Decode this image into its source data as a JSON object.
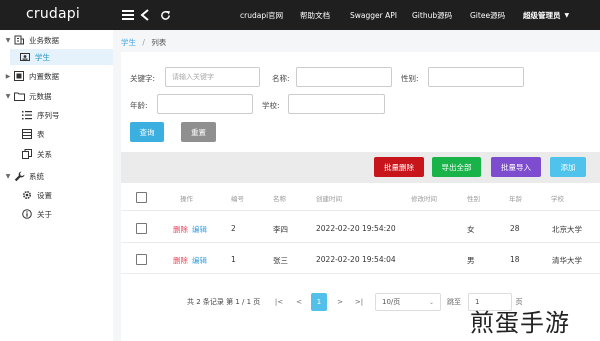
{
  "header": {
    "logo": "crudapi",
    "nav": [
      "crudapi官网",
      "帮助文档",
      "Swagger API",
      "Github源码",
      "Gitee源码"
    ],
    "user": "超级管理员"
  },
  "sidebar": {
    "items": [
      {
        "label": "业务数据",
        "level": 0,
        "expanded": true
      },
      {
        "label": "学生",
        "level": 1,
        "active": true
      },
      {
        "label": "内置数据",
        "level": 0,
        "expanded": false
      },
      {
        "label": "元数据",
        "level": 0,
        "expanded": true
      },
      {
        "label": "序列号",
        "level": 1
      },
      {
        "label": "表",
        "level": 1
      },
      {
        "label": "关系",
        "level": 1
      },
      {
        "label": "系统",
        "level": 0,
        "expanded": true
      },
      {
        "label": "设置",
        "level": 1
      },
      {
        "label": "关于",
        "level": 1
      }
    ]
  },
  "breadcrumb": {
    "parent": "学生",
    "separator": "/",
    "current": "列表"
  },
  "search": {
    "keyword_label": "关键字:",
    "keyword_placeholder": "请输入关键字",
    "name_label": "名称:",
    "gender_label": "性别:",
    "age_label": "年龄:",
    "school_label": "学校:",
    "query_button": "查询",
    "reset_button": "重置"
  },
  "toolbar": {
    "batch_delete": "批量删除",
    "export_all": "导出全部",
    "batch_import": "批量导入",
    "add": "添加"
  },
  "table": {
    "headers": [
      "操作",
      "编号",
      "名称",
      "创建时间",
      "修改时间",
      "性别",
      "年龄",
      "学校"
    ],
    "delete_label": "删除",
    "edit_label": "编辑",
    "rows": [
      {
        "id": "2",
        "name": "李四",
        "created": "2022-02-20 19:54:20",
        "updated": "",
        "gender": "女",
        "age": "28",
        "school": "北京大学"
      },
      {
        "id": "1",
        "name": "张三",
        "created": "2022-02-20 19:54:04",
        "updated": "",
        "gender": "男",
        "age": "18",
        "school": "清华大学"
      }
    ]
  },
  "pagination": {
    "summary": "共 2 条记录 第 1 / 1 页",
    "first": "|<",
    "prev": "<",
    "current_page": "1",
    "next": ">",
    "last": ">|",
    "page_size": "10/页",
    "jump_label": "跳至",
    "jump_value": "1",
    "page_unit": "页"
  },
  "watermark": "煎蛋手游",
  "colors": {
    "header_bg": "#1f1f1f",
    "primary": "#3ba0e0",
    "query_btn": "#3bb0e0",
    "reset_btn": "#8f8f8f",
    "danger": "#c8151b",
    "success": "#1ab34a",
    "purple": "#7d4ccf",
    "cyan": "#4fc3ec"
  }
}
